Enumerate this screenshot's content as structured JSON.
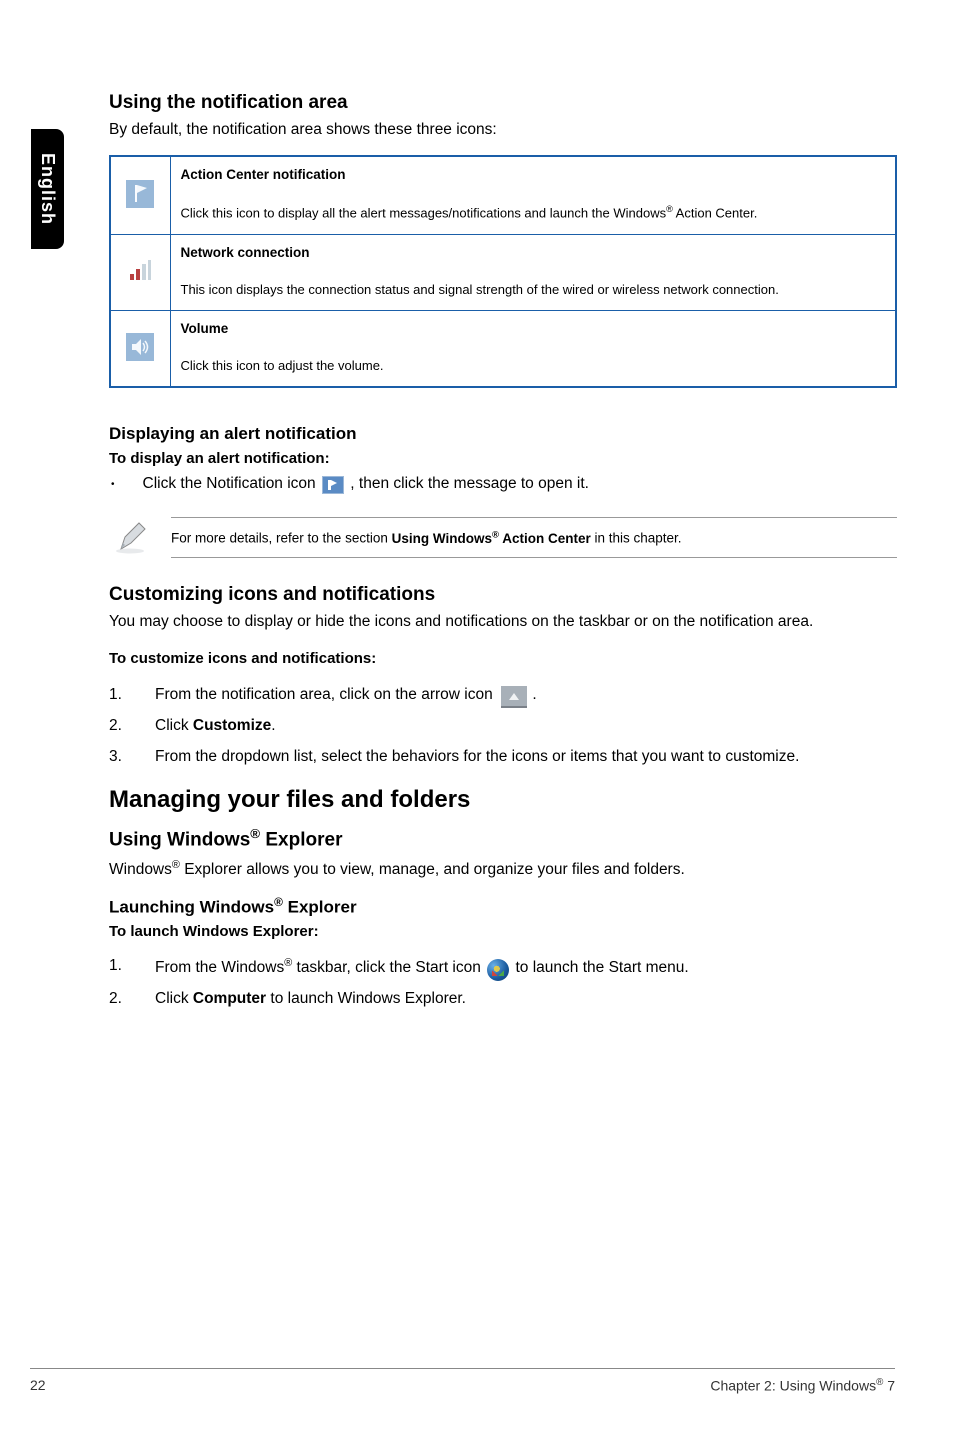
{
  "sideTab": "English",
  "sections": {
    "notificationArea": {
      "heading": "Using the notification area",
      "intro": "By default, the notification area shows these three icons:",
      "table": [
        {
          "title": "Action Center notification",
          "desc_pre": "Click this icon to display all the alert messages/notifications and launch the Windows",
          "desc_post": " Action Center."
        },
        {
          "title": "Network connection",
          "desc": "This icon displays the connection status and signal strength of the wired or wireless network connection."
        },
        {
          "title": "Volume",
          "desc": "Click this icon to adjust the volume."
        }
      ]
    },
    "displayAlert": {
      "heading": "Displaying an alert notification",
      "subHeading": "To display an alert notification:",
      "bullet_pre": "Click the Notification icon ",
      "bullet_post": ", then click the message to open it.",
      "note_pre": "For more details, refer to the section ",
      "note_bold_pre": "Using Windows",
      "note_bold_post": " Action Center",
      "note_post": " in this chapter."
    },
    "customizing": {
      "heading": "Customizing icons and notifications",
      "intro": "You may choose to display or hide the icons and notifications on the taskbar or on the notification area.",
      "subHeading": "To customize icons and notifications:",
      "steps": {
        "s1_pre": "From the notification area, click on the arrow icon ",
        "s1_post": ".",
        "s2_pre": "Click ",
        "s2_bold": "Customize",
        "s2_post": ".",
        "s3": "From the dropdown list, select the behaviors for the icons or items that you want to customize."
      }
    },
    "managing": {
      "heading": "Managing your files and folders",
      "usingExplorer": {
        "heading_pre": "Using Windows",
        "heading_post": " Explorer",
        "intro_pre": "Windows",
        "intro_post": " Explorer allows you to view, manage, and organize your files and folders."
      },
      "launching": {
        "heading_pre": "Launching Windows",
        "heading_post": " Explorer",
        "subHeading": "To launch Windows Explorer:",
        "steps": {
          "s1_pre1": "From the Windows",
          "s1_pre2": " taskbar, click the Start icon ",
          "s1_post": " to launch the Start menu.",
          "s2_pre": "Click ",
          "s2_bold": "Computer",
          "s2_post": " to launch Windows Explorer."
        }
      }
    }
  },
  "footer": {
    "pageNum": "22",
    "chapter_pre": "Chapter 2: Using Windows",
    "chapter_post": " 7"
  },
  "reg": "®"
}
